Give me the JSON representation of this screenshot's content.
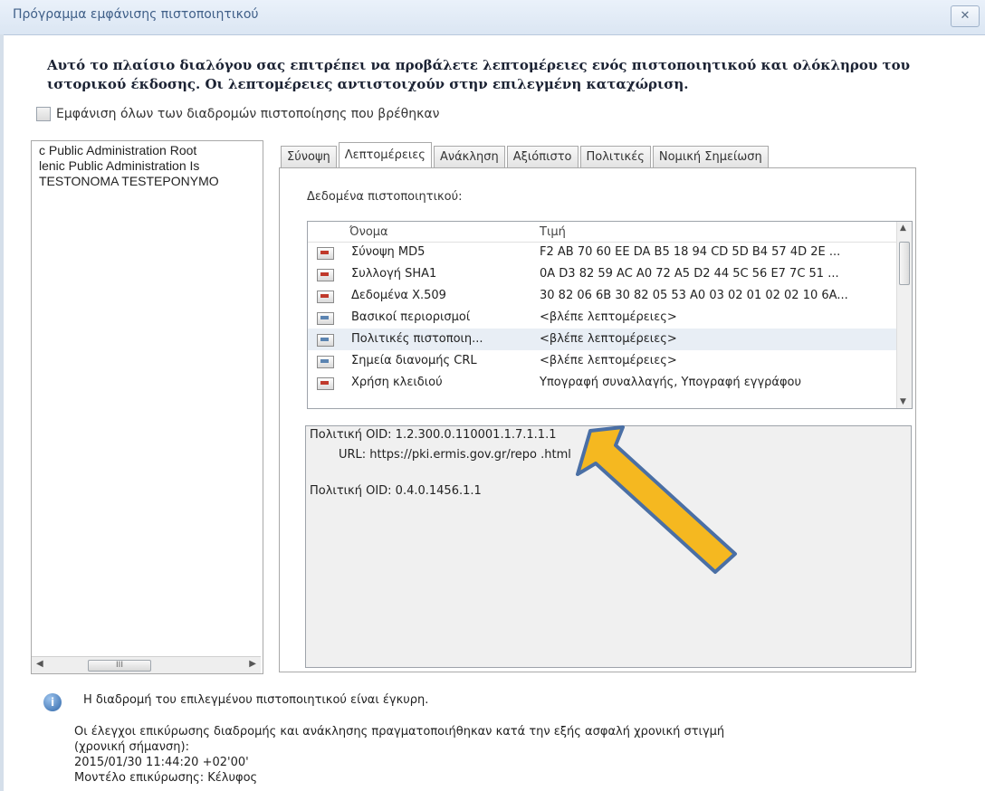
{
  "window": {
    "title": "Πρόγραμμα εμφάνισης πιστοποιητικού",
    "close_label": "✕"
  },
  "header": {
    "line1": "Αυτό το πλαίσιο διαλόγου σας επιτρέπει να προβάλετε λεπτομέρειες ενός πιστοποιητικού και ολόκληρου του",
    "line2": "ιστορικού έκδοσης. Οι λεπτομέρειες αντιστοιχούν στην επιλεγμένη καταχώριση."
  },
  "show_all_paths": {
    "label": "Εμφάνιση όλων των διαδρομών πιστοποίησης που βρέθηκαν",
    "checked": false
  },
  "chain": {
    "items": [
      "c Public Administration Root",
      "lenic Public Administration Is",
      "TESTONOMA TESTEPONYMO"
    ],
    "scroll_thumb": "III"
  },
  "tabs": [
    {
      "label": "Σύνοψη",
      "active": false
    },
    {
      "label": "Λεπτομέρειες",
      "active": true
    },
    {
      "label": "Ανάκληση",
      "active": false
    },
    {
      "label": "Αξιόπιστο",
      "active": false
    },
    {
      "label": "Πολιτικές",
      "active": false
    },
    {
      "label": "Νομική Σημείωση",
      "active": false
    }
  ],
  "details": {
    "section_label": "Δεδομένα πιστοποιητικού:",
    "columns": {
      "name": "Όνομα",
      "value": "Τιμή"
    },
    "rows": [
      {
        "name": "Σύνοψη MD5",
        "value": "F2 AB 70 60 EE DA B5 18 94 CD 5D B4 57 4D 2E ...",
        "icon": "certificate-field-icon"
      },
      {
        "name": "Συλλογή SHA1",
        "value": "0A D3 82 59 AC A0 72 A5 D2 44 5C 56 E7 7C 51 ...",
        "icon": "certificate-field-icon"
      },
      {
        "name": "Δεδομένα X.509",
        "value": "30 82 06 6B 30 82 05 53 A0 03 02 01 02 02 10 6A...",
        "icon": "certificate-field-icon"
      },
      {
        "name": "Βασικοί περιορισμοί",
        "value": "<βλέπε λεπτομέρειες>",
        "icon": "certificate-field-icon"
      },
      {
        "name": "Πολιτικές πιστοποιη...",
        "value": "<βλέπε λεπτομέρειες>",
        "icon": "certificate-field-icon",
        "selected": true
      },
      {
        "name": "Σημεία διανομής CRL",
        "value": "<βλέπε λεπτομέρειες>",
        "icon": "certificate-field-icon"
      },
      {
        "name": "Χρήση κλειδιού",
        "value": "Υπογραφή συναλλαγής, Υπογραφή εγγράφου",
        "icon": "certificate-field-icon"
      }
    ],
    "detail_text": {
      "line1": "Πολιτική OID: 1.2.300.0.110001.1.7.1.1.1",
      "line2": "URL: https://pki.ermis.gov.gr/repo    .html",
      "line3": "Πολιτική OID: 0.4.0.1456.1.1"
    }
  },
  "status": {
    "icon": "info-icon",
    "valid_text": "Η διαδρομή του επιλεγμένου πιστοποιητικού είναι έγκυρη.",
    "info_line1": "Οι έλεγχοι επικύρωσης διαδρομής και ανάκλησης πραγματοποιήθηκαν κατά την εξής ασφαλή χρονική στιγμή",
    "info_line2": "(χρονική σήμανση):",
    "timestamp": "2015/01/30 11:44:20 +02'00'",
    "model": "Μοντέλο επικύρωσης: Κέλυφος"
  },
  "colors": {
    "arrow": "#f5b820",
    "arrow_outline": "#4a6fa5",
    "selected_row": "#e8eef5"
  }
}
